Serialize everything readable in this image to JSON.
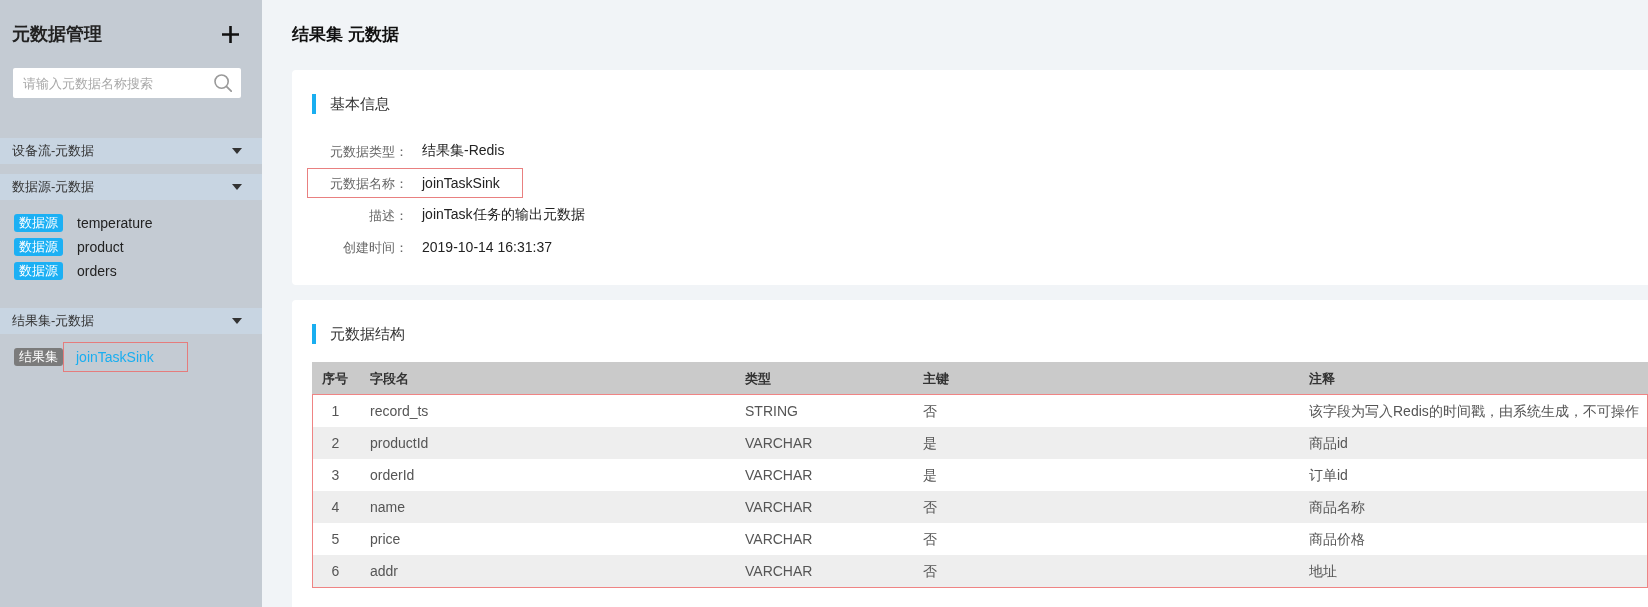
{
  "sidebar": {
    "title": "元数据管理",
    "search": {
      "placeholder": "请输入元数据名称搜索"
    },
    "sections": [
      {
        "title": "设备流-元数据"
      },
      {
        "title": "数据源-元数据",
        "items": [
          {
            "badge": "数据源",
            "kind": "source",
            "name": "temperature",
            "selected": false,
            "highlighted": false
          },
          {
            "badge": "数据源",
            "kind": "source",
            "name": "product",
            "selected": false,
            "highlighted": false
          },
          {
            "badge": "数据源",
            "kind": "source",
            "name": "orders",
            "selected": false,
            "highlighted": false
          }
        ]
      },
      {
        "title": "结果集-元数据",
        "items": [
          {
            "badge": "结果集",
            "kind": "sink",
            "name": "joinTaskSink",
            "selected": true,
            "highlighted": true
          }
        ]
      }
    ]
  },
  "page_title": "结果集 元数据",
  "basic_info": {
    "heading": "基本信息",
    "rows": [
      {
        "label": "元数据类型：",
        "value": "结果集-Redis",
        "highlighted": false
      },
      {
        "label": "元数据名称：",
        "value": "joinTaskSink",
        "highlighted": true
      },
      {
        "label": "描述：",
        "value": "joinTask任务的输出元数据",
        "highlighted": false
      },
      {
        "label": "创建时间：",
        "value": "2019-10-14 16:31:37",
        "highlighted": false
      }
    ]
  },
  "structure": {
    "heading": "元数据结构",
    "table": {
      "columns": [
        "序号",
        "字段名",
        "类型",
        "主键",
        "注释"
      ],
      "highlighted": true,
      "rows": [
        [
          "1",
          "record_ts",
          "STRING",
          "否",
          "该字段为写入Redis的时间戳，由系统生成，不可操作"
        ],
        [
          "2",
          "productId",
          "VARCHAR",
          "是",
          "商品id"
        ],
        [
          "3",
          "orderId",
          "VARCHAR",
          "是",
          "订单id"
        ],
        [
          "4",
          "name",
          "VARCHAR",
          "否",
          "商品名称"
        ],
        [
          "5",
          "price",
          "VARCHAR",
          "否",
          "商品价格"
        ],
        [
          "6",
          "addr",
          "VARCHAR",
          "否",
          "地址"
        ]
      ]
    }
  }
}
